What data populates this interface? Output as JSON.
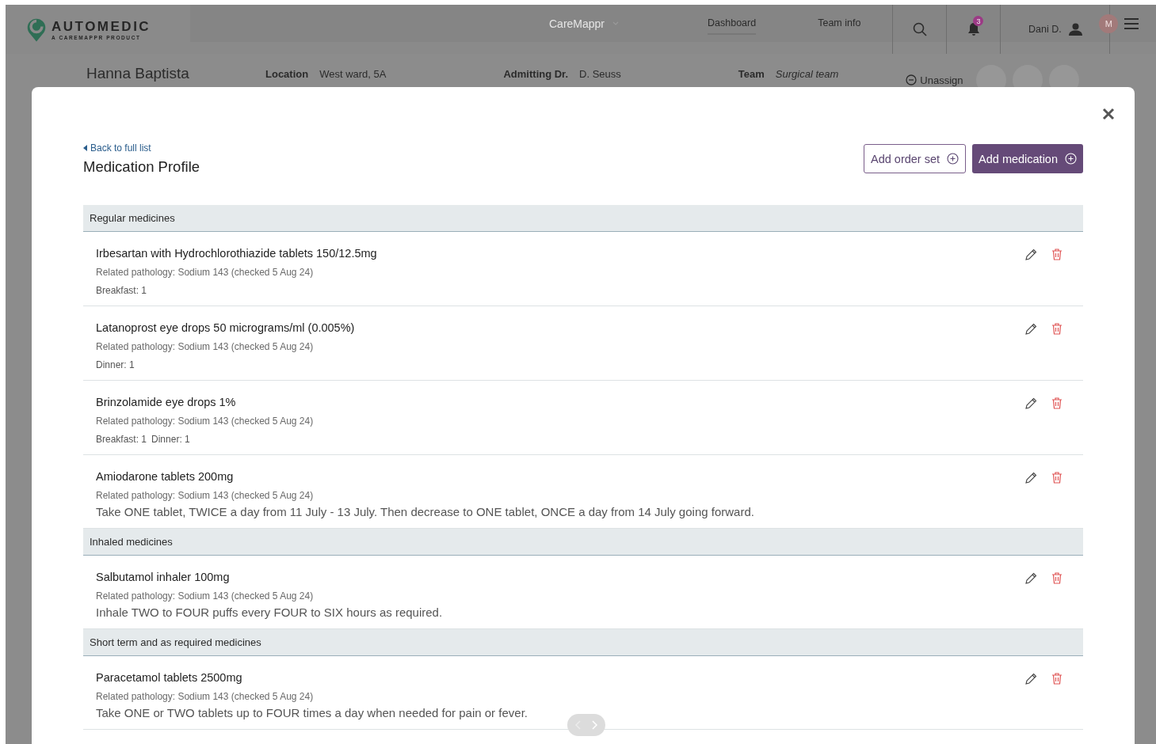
{
  "header": {
    "logo": {
      "name": "AUTOMEDIC",
      "tagline": "A CAREMAPPR PRODUCT"
    },
    "product_switcher": "CareMappr",
    "nav": [
      {
        "label": "Dashboard",
        "selected": true
      },
      {
        "label": "Team info",
        "selected": false
      }
    ],
    "notifications": {
      "count": "3"
    },
    "user": "Dani D.",
    "avatars": [
      "M"
    ]
  },
  "patient": {
    "name": "Hanna Baptista",
    "fields": [
      {
        "label": "Location",
        "value": "West ward, 5A",
        "italic": false
      },
      {
        "label": "Admitting Dr.",
        "value": "D. Seuss",
        "italic": false
      },
      {
        "label": "Team",
        "value": "Surgical team",
        "italic": true
      }
    ],
    "unassign": "Unassign"
  },
  "modal": {
    "back_link": "Back to full list",
    "title": "Medication Profile",
    "buttons": [
      {
        "label": "Add order set",
        "kind": "secondary"
      },
      {
        "label": "Add medication",
        "kind": "primary"
      }
    ],
    "groups": [
      {
        "title": "Regular medicines",
        "items": [
          {
            "name": "Irbesartan with Hydrochlorothiazide tablets 150/12.5mg",
            "pathology": "Related pathology: Sodium 143 (checked 5 Aug 24)",
            "kind": "doses",
            "doses": [
              "Breakfast: 1"
            ]
          },
          {
            "name": "Latanoprost eye drops 50 micrograms/ml (0.005%)",
            "pathology": "Related pathology: Sodium 143 (checked 5 Aug 24)",
            "kind": "doses",
            "doses": [
              "Dinner: 1"
            ]
          },
          {
            "name": "Brinzolamide eye drops 1%",
            "pathology": "Related pathology: Sodium 143 (checked 5 Aug 24)",
            "kind": "doses",
            "doses": [
              "Breakfast: 1",
              "Dinner: 1"
            ]
          },
          {
            "name": "Amiodarone tablets 200mg",
            "pathology": "Related pathology: Sodium 143 (checked 5 Aug 24)",
            "kind": "instruction",
            "instruction": "Take ONE tablet, TWICE a day from 11 July - 13 July. Then decrease to ONE tablet, ONCE a day from 14 July going forward."
          }
        ]
      },
      {
        "title": "Inhaled medicines",
        "items": [
          {
            "name": "Salbutamol inhaler 100mg",
            "pathology": "Related pathology: Sodium 143 (checked 5 Aug 24)",
            "kind": "instruction",
            "instruction": "Inhale TWO to FOUR puffs every FOUR to SIX hours as required."
          }
        ]
      },
      {
        "title": "Short term and as required medicines",
        "items": [
          {
            "name": "Paracetamol tablets 2500mg",
            "pathology": "Related pathology: Sodium 143 (checked 5 Aug 24)",
            "kind": "instruction",
            "instruction": "Take ONE or TWO tablets up to FOUR times a day when needed for pain or fever."
          }
        ]
      }
    ]
  }
}
